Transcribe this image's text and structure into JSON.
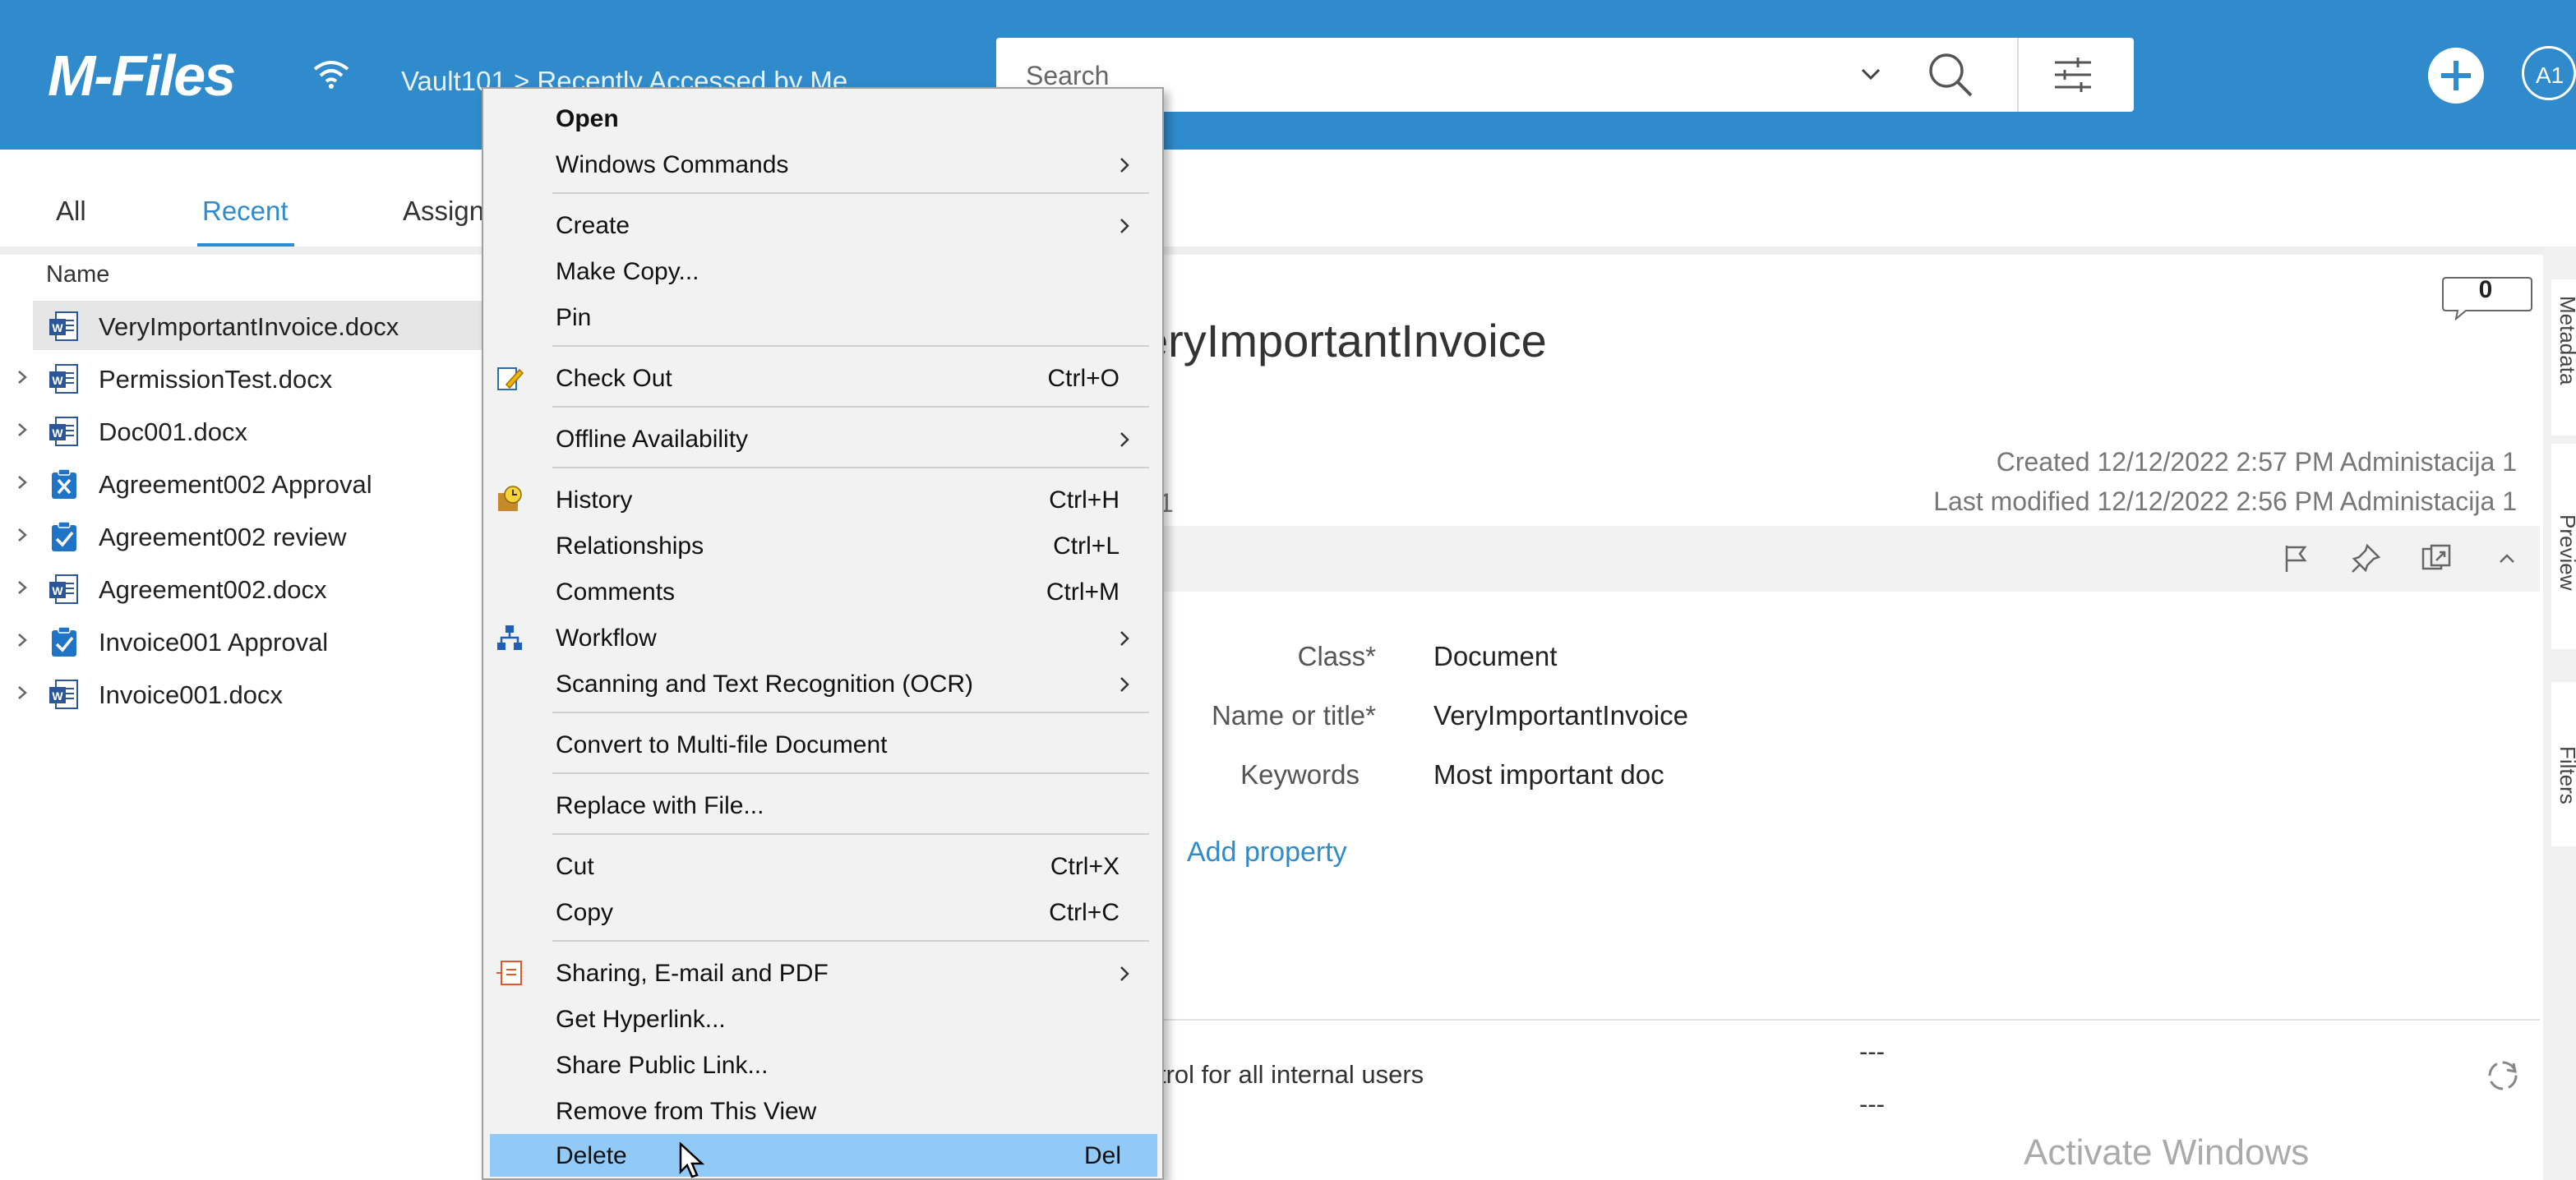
{
  "app": {
    "logo": "M-Files",
    "breadcrumb": "Vault101 > Recently Accessed by Me"
  },
  "search": {
    "placeholder": "Search"
  },
  "avatar": "A1",
  "tabs": [
    {
      "label": "All"
    },
    {
      "label": "Recent"
    },
    {
      "label": "Assign"
    }
  ],
  "list": {
    "header": "Name",
    "items": [
      {
        "name": "VeryImportantInvoice.docx",
        "icon": "word-document-icon"
      },
      {
        "name": "PermissionTest.docx",
        "icon": "word-document-icon"
      },
      {
        "name": "Doc001.docx",
        "icon": "word-document-icon"
      },
      {
        "name": "Agreement002 Approval",
        "icon": "rejected-assignment-icon"
      },
      {
        "name": "Agreement002 review",
        "icon": "completed-assignment-icon"
      },
      {
        "name": "Agreement002.docx",
        "icon": "word-document-icon"
      },
      {
        "name": "Invoice001 Approval",
        "icon": "completed-assignment-icon"
      },
      {
        "name": "Invoice001.docx",
        "icon": "word-document-icon"
      }
    ]
  },
  "metadata": {
    "title": "eryImportantInvoice",
    "comments_count": "0",
    "created": "Created 12/12/2022 2:57 PM Administacija 1",
    "modified": "Last modified 12/12/2022 2:56 PM Administacija 1",
    "owner_fragment": "1",
    "properties": [
      {
        "label": "Class*",
        "value": "Document"
      },
      {
        "label": "Name or title*",
        "value": "VeryImportantInvoice"
      },
      {
        "label": "Keywords",
        "value": "Most important doc"
      }
    ],
    "add_property": "Add property",
    "permissions_fragment": "trol for all internal users",
    "dash1": "---",
    "dash2": "---"
  },
  "side_tabs": {
    "metadata": "Metadata",
    "preview": "Preview",
    "filters": "Filters"
  },
  "watermark": "Activate Windows",
  "context_menu": {
    "items": [
      {
        "label": "Open",
        "shortcut": "",
        "submenu": false
      },
      {
        "label": "Windows Commands",
        "shortcut": "",
        "submenu": true
      },
      {
        "label": "Create",
        "shortcut": "",
        "submenu": true
      },
      {
        "label": "Make Copy...",
        "shortcut": "",
        "submenu": false
      },
      {
        "label": "Pin",
        "shortcut": "",
        "submenu": false
      },
      {
        "label": "Check Out",
        "shortcut": "Ctrl+O",
        "submenu": false
      },
      {
        "label": "Offline Availability",
        "shortcut": "",
        "submenu": true
      },
      {
        "label": "History",
        "shortcut": "Ctrl+H",
        "submenu": false
      },
      {
        "label": "Relationships",
        "shortcut": "Ctrl+L",
        "submenu": false
      },
      {
        "label": "Comments",
        "shortcut": "Ctrl+M",
        "submenu": false
      },
      {
        "label": "Workflow",
        "shortcut": "",
        "submenu": true
      },
      {
        "label": "Scanning and Text Recognition (OCR)",
        "shortcut": "",
        "submenu": true
      },
      {
        "label": "Convert to Multi-file Document",
        "shortcut": "",
        "submenu": false
      },
      {
        "label": "Replace with File...",
        "shortcut": "",
        "submenu": false
      },
      {
        "label": "Cut",
        "shortcut": "Ctrl+X",
        "submenu": false
      },
      {
        "label": "Copy",
        "shortcut": "Ctrl+C",
        "submenu": false
      },
      {
        "label": "Sharing, E-mail and PDF",
        "shortcut": "",
        "submenu": true
      },
      {
        "label": "Get Hyperlink...",
        "shortcut": "",
        "submenu": false
      },
      {
        "label": "Share Public Link...",
        "shortcut": "",
        "submenu": false
      },
      {
        "label": "Remove from This View",
        "shortcut": "",
        "submenu": false
      },
      {
        "label": "Delete",
        "shortcut": "Del",
        "submenu": false,
        "highlighted": true
      }
    ]
  },
  "colors": {
    "accent": "#2f8bcb",
    "menu_highlight": "#91c9f7"
  }
}
